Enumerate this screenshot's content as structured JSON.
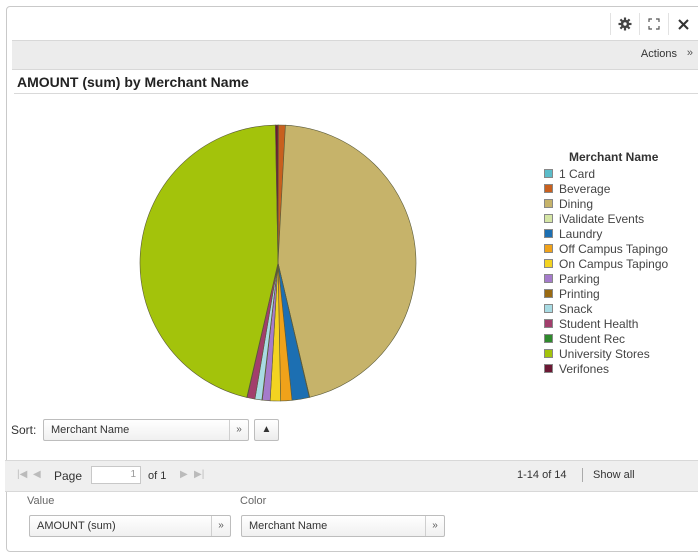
{
  "window": {
    "icons": [
      "gear-icon",
      "expand-icon",
      "close-icon"
    ]
  },
  "toolbar": {
    "actions_label": "Actions"
  },
  "chart_title": "AMOUNT (sum) by Merchant Name",
  "legend": {
    "title": "Merchant Name"
  },
  "chart_data": {
    "type": "pie",
    "title": "AMOUNT (sum) by Merchant Name",
    "legend_title": "Merchant Name",
    "legend_position": "right",
    "slices": [
      {
        "label": "1 Card",
        "value": 0.05,
        "color": "#5bbcc9"
      },
      {
        "label": "Beverage",
        "value": 0.8,
        "color": "#c8601e"
      },
      {
        "label": "Dining",
        "value": 45.0,
        "color": "#c6b36a"
      },
      {
        "label": "iValidate Events",
        "value": 0.05,
        "color": "#d5e6a5"
      },
      {
        "label": "Laundry",
        "value": 2.0,
        "color": "#1c6fb2"
      },
      {
        "label": "Off Campus Tapingo",
        "value": 1.3,
        "color": "#f0a21a"
      },
      {
        "label": "On Campus Tapingo",
        "value": 1.2,
        "color": "#f3d321"
      },
      {
        "label": "Parking",
        "value": 0.9,
        "color": "#a57bcb"
      },
      {
        "label": "Printing",
        "value": 0.05,
        "color": "#9a6a12"
      },
      {
        "label": "Snack",
        "value": 0.8,
        "color": "#a8dbe3"
      },
      {
        "label": "Student Health",
        "value": 0.9,
        "color": "#a23e6c"
      },
      {
        "label": "Student Rec",
        "value": 0.05,
        "color": "#2f8a2c"
      },
      {
        "label": "University Stores",
        "value": 45.6,
        "color": "#a3c30b"
      },
      {
        "label": "Verifones",
        "value": 0.3,
        "color": "#6b1834"
      }
    ]
  },
  "sort": {
    "label": "Sort:",
    "value": "Merchant Name"
  },
  "pager": {
    "page_label": "Page",
    "page_value": "1",
    "of_label": "of 1",
    "range": "1-14 of 14",
    "show_all": "Show all"
  },
  "fields": {
    "value_label": "Value",
    "value_selected": "AMOUNT (sum)",
    "color_label": "Color",
    "color_selected": "Merchant Name"
  }
}
